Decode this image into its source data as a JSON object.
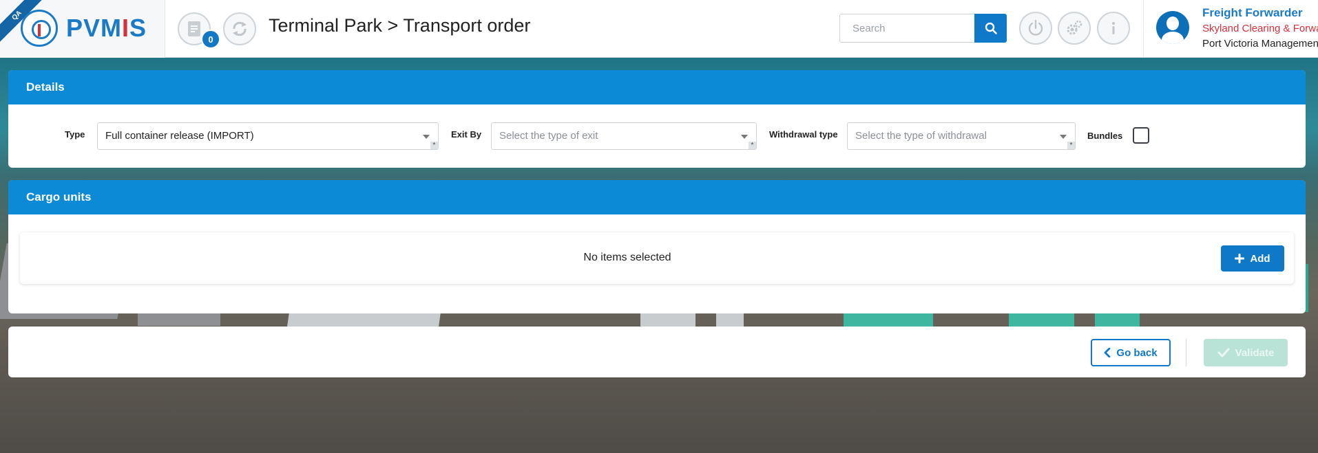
{
  "header": {
    "qa_ribbon": "QA",
    "logo_main": "PVM",
    "logo_accent": "I",
    "logo_tail": "S",
    "notification_count": "0",
    "page_title": "Terminal Park > Transport order",
    "search_placeholder": "Search",
    "icons": [
      "document-icon",
      "refresh-icon",
      "power-icon",
      "settings-icon",
      "info-icon",
      "search-icon"
    ]
  },
  "user": {
    "role": "Freight Forwarder",
    "company": "Skyland Clearing & Forwarding",
    "organization": "Port Victoria Management"
  },
  "details": {
    "title": "Details",
    "type_label": "Type",
    "type_value": "Full container release (IMPORT)",
    "exit_label": "Exit By",
    "exit_placeholder": "Select the type of exit",
    "withdrawal_label": "Withdrawal type",
    "withdrawal_placeholder": "Select the type of withdrawal",
    "bundles_label": "Bundles",
    "required_marker": "*"
  },
  "cargo": {
    "title": "Cargo units",
    "empty_message": "No items selected",
    "add_label": "Add"
  },
  "actions": {
    "back_label": "Go back",
    "validate_label": "Validate"
  },
  "colors": {
    "primary": "#0f78c8",
    "panel_header": "#0c8ad6",
    "accent_red": "#d6303d",
    "validate_disabled": "#b9e3d6"
  }
}
